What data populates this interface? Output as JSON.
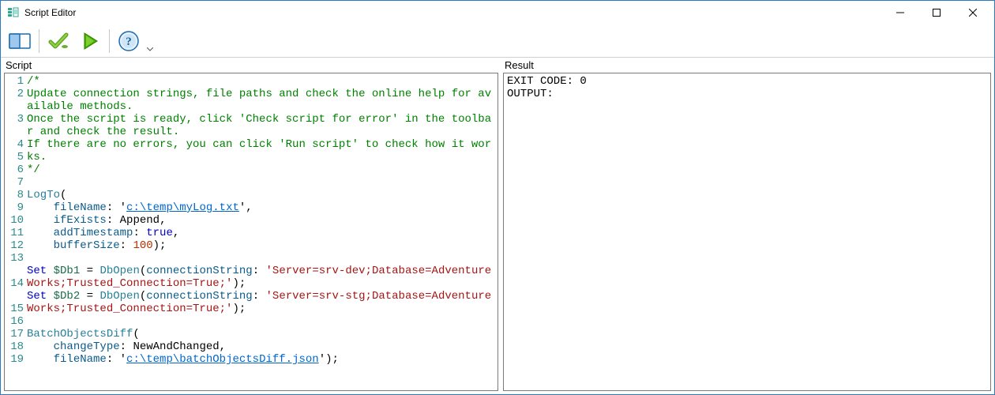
{
  "window": {
    "title": "Script Editor"
  },
  "toolbar": {
    "items": [
      {
        "name": "panels-button",
        "icon": "panels"
      },
      {
        "name": "check-script-button",
        "icon": "check"
      },
      {
        "name": "run-script-button",
        "icon": "play"
      },
      {
        "name": "help-button",
        "icon": "help"
      }
    ]
  },
  "panels": {
    "script_label": "Script",
    "result_label": "Result"
  },
  "script": {
    "lines": [
      {
        "n": 1,
        "tokens": [
          [
            "comment",
            "/*"
          ]
        ]
      },
      {
        "n": 2,
        "tokens": [
          [
            "comment",
            "Update connection strings, file paths and check the online help for available methods."
          ]
        ]
      },
      {
        "n": 3,
        "tokens": [
          [
            "comment",
            "Once the script is ready, click 'Check script for error' in the toolbar and check the result."
          ]
        ]
      },
      {
        "n": 4,
        "tokens": [
          [
            "comment",
            "If there are no errors, you can click 'Run script' to check how it works."
          ]
        ]
      },
      {
        "n": 5,
        "tokens": [
          [
            "comment",
            "*/"
          ]
        ]
      },
      {
        "n": 6,
        "tokens": []
      },
      {
        "n": 7,
        "tokens": [
          [
            "func",
            "LogTo"
          ],
          [
            "op",
            "("
          ]
        ]
      },
      {
        "n": 8,
        "tokens": [
          [
            "ind",
            "    "
          ],
          [
            "param",
            "fileName"
          ],
          [
            "op",
            ": '"
          ],
          [
            "link",
            "c:\\temp\\myLog.txt"
          ],
          [
            "op",
            "',"
          ]
        ]
      },
      {
        "n": 9,
        "tokens": [
          [
            "ind",
            "    "
          ],
          [
            "param",
            "ifExists"
          ],
          [
            "op",
            ": "
          ],
          [
            "plain",
            "Append"
          ],
          [
            "op",
            ","
          ]
        ]
      },
      {
        "n": 10,
        "tokens": [
          [
            "ind",
            "    "
          ],
          [
            "param",
            "addTimestamp"
          ],
          [
            "op",
            ": "
          ],
          [
            "kw",
            "true"
          ],
          [
            "op",
            ","
          ]
        ]
      },
      {
        "n": 11,
        "tokens": [
          [
            "ind",
            "    "
          ],
          [
            "param",
            "bufferSize"
          ],
          [
            "op",
            ": "
          ],
          [
            "num",
            "100"
          ],
          [
            "op",
            ");"
          ]
        ]
      },
      {
        "n": 12,
        "tokens": []
      },
      {
        "n": 13,
        "tokens": [
          [
            "kw",
            "Set"
          ],
          [
            "op",
            " "
          ],
          [
            "var",
            "$Db1"
          ],
          [
            "op",
            " = "
          ],
          [
            "func",
            "DbOpen"
          ],
          [
            "op",
            "("
          ],
          [
            "param",
            "connectionString"
          ],
          [
            "op",
            ": "
          ],
          [
            "string",
            "'Server=srv-dev;Database=AdventureWorks;Trusted_Connection=True;'"
          ],
          [
            "op",
            ");"
          ]
        ]
      },
      {
        "n": 14,
        "tokens": [
          [
            "kw",
            "Set"
          ],
          [
            "op",
            " "
          ],
          [
            "var",
            "$Db2"
          ],
          [
            "op",
            " = "
          ],
          [
            "func",
            "DbOpen"
          ],
          [
            "op",
            "("
          ],
          [
            "param",
            "connectionString"
          ],
          [
            "op",
            ": "
          ],
          [
            "string",
            "'Server=srv-stg;Database=AdventureWorks;Trusted_Connection=True;'"
          ],
          [
            "op",
            ");"
          ]
        ]
      },
      {
        "n": 15,
        "tokens": []
      },
      {
        "n": 16,
        "tokens": [
          [
            "func",
            "BatchObjectsDiff"
          ],
          [
            "op",
            "("
          ]
        ]
      },
      {
        "n": 17,
        "tokens": [
          [
            "ind",
            "    "
          ],
          [
            "param",
            "changeType"
          ],
          [
            "op",
            ": "
          ],
          [
            "plain",
            "NewAndChanged"
          ],
          [
            "op",
            ","
          ]
        ]
      },
      {
        "n": 18,
        "tokens": [
          [
            "ind",
            "    "
          ],
          [
            "param",
            "fileName"
          ],
          [
            "op",
            ": '"
          ],
          [
            "link",
            "c:\\temp\\batchObjectsDiff.json"
          ],
          [
            "op",
            "');"
          ]
        ]
      },
      {
        "n": 19,
        "tokens": []
      }
    ]
  },
  "result": {
    "exit_code_label": "EXIT CODE: ",
    "exit_code_value": "0",
    "output_label": "OUTPUT:"
  }
}
